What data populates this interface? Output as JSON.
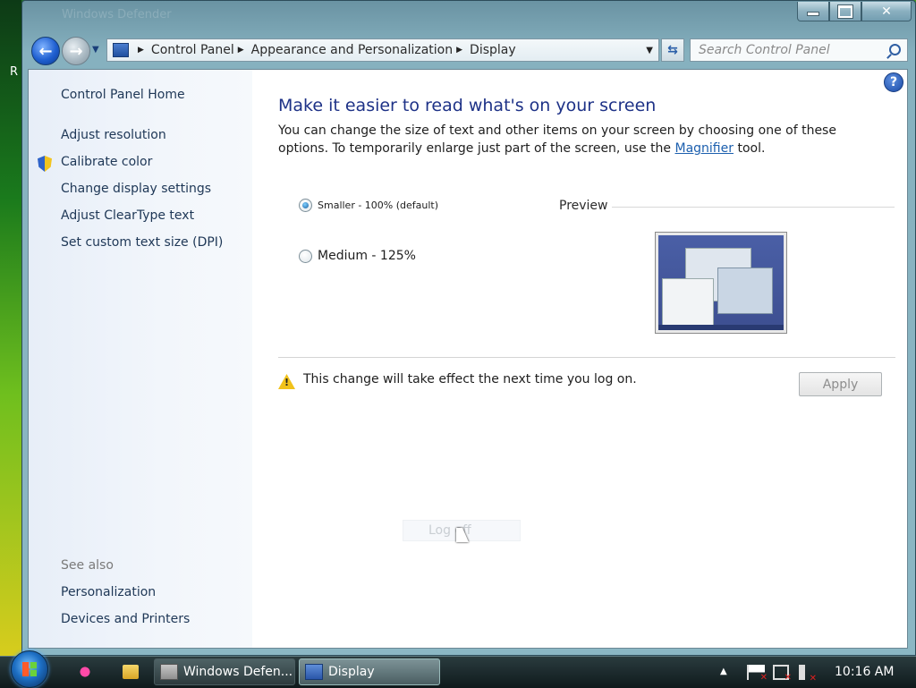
{
  "desktop": {
    "edge_letter": "R"
  },
  "window": {
    "ghost_title": "Windows Defender"
  },
  "nav": {
    "breadcrumbs": [
      "Control Panel",
      "Appearance and Personalization",
      "Display"
    ],
    "search_placeholder": "Search Control Panel"
  },
  "sidebar": {
    "home": "Control Panel Home",
    "links": [
      "Adjust resolution",
      "Calibrate color",
      "Change display settings",
      "Adjust ClearType text",
      "Set custom text size (DPI)"
    ],
    "see_also_title": "See also",
    "see_also": [
      "Personalization",
      "Devices and Printers"
    ]
  },
  "main": {
    "title": "Make it easier to read what's on your screen",
    "intro_before": "You can change the size of text and other items on your screen by choosing one of these options. To temporarily enlarge just part of the screen, use the ",
    "intro_link": "Magnifier",
    "intro_after": " tool.",
    "options": [
      {
        "label": "Smaller - 100% (default)",
        "checked": true
      },
      {
        "label": "Medium - 125%",
        "checked": false
      }
    ],
    "preview_label": "Preview",
    "warning": "This change will take effect the next time you log on.",
    "apply_label": "Apply",
    "overlay_text": "Log off"
  },
  "taskbar": {
    "tasks": [
      "Windows Defen...",
      "Display"
    ],
    "clock": "10:16 AM"
  },
  "colors": {
    "title_blue": "#1e3287",
    "link_blue": "#1c5fae",
    "sidebar_text": "#1e3756"
  }
}
